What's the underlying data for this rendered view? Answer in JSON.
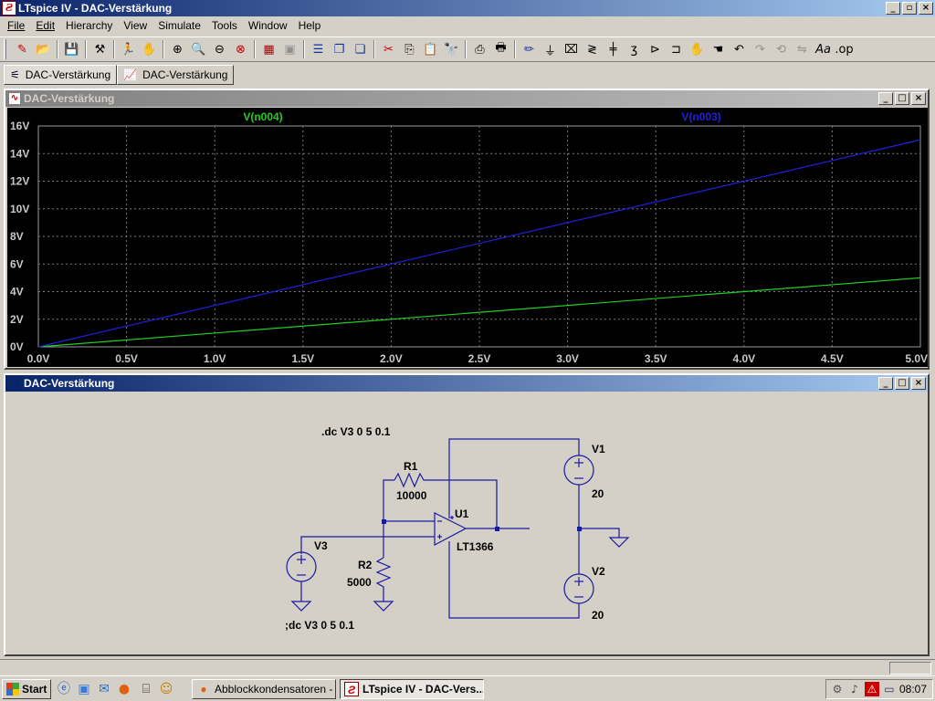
{
  "window": {
    "title": "LTspice IV - DAC-Verstärkung",
    "min": "_",
    "max": "▫",
    "close": "×"
  },
  "menu": [
    "File",
    "Edit",
    "Hierarchy",
    "View",
    "Simulate",
    "Tools",
    "Window",
    "Help"
  ],
  "tabs": [
    {
      "label": "DAC-Verstärkung",
      "icon": "schematic-icon"
    },
    {
      "label": "DAC-Verstärkung",
      "icon": "waveform-icon"
    }
  ],
  "plot_window": {
    "title": "DAC-Verstärkung"
  },
  "schematic_window": {
    "title": "DAC-Verstärkung"
  },
  "chart_data": {
    "type": "line",
    "background": "#000000",
    "grid": true,
    "x_ticks": [
      "0.0V",
      "0.5V",
      "1.0V",
      "1.5V",
      "2.0V",
      "2.5V",
      "3.0V",
      "3.5V",
      "4.0V",
      "4.5V",
      "5.0V"
    ],
    "y_ticks": [
      "0V",
      "2V",
      "4V",
      "6V",
      "8V",
      "10V",
      "12V",
      "14V",
      "16V"
    ],
    "xlim": [
      0,
      5
    ],
    "ylim": [
      0,
      16
    ],
    "series": [
      {
        "name": "V(n004)",
        "color": "#22cc22",
        "x": [
          0,
          5
        ],
        "y": [
          0,
          5
        ]
      },
      {
        "name": "V(n003)",
        "color": "#2020dd",
        "x": [
          0,
          5
        ],
        "y": [
          0,
          15
        ]
      }
    ]
  },
  "schematic": {
    "directive1": ".dc V3 0 5 0.1",
    "directive2": ";dc V3 0 5 0.1",
    "r1_name": "R1",
    "r1_value": "10000",
    "r2_name": "R2",
    "r2_value": "5000",
    "u1_name": "U1",
    "u1_part": "LT1366",
    "v1_name": "V1",
    "v1_value": "20",
    "v2_name": "V2",
    "v2_value": "20",
    "v3_name": "V3",
    "wire_color": "#1a1aa0",
    "text_color": "#000000"
  },
  "taskbar": {
    "start": "Start",
    "tasks": [
      {
        "label": "Abblockkondensatoren - ...",
        "icon": "firefox-icon"
      },
      {
        "label": "LTspice IV - DAC-Vers...",
        "icon": "ltspice-icon"
      }
    ],
    "clock": "08:07"
  }
}
